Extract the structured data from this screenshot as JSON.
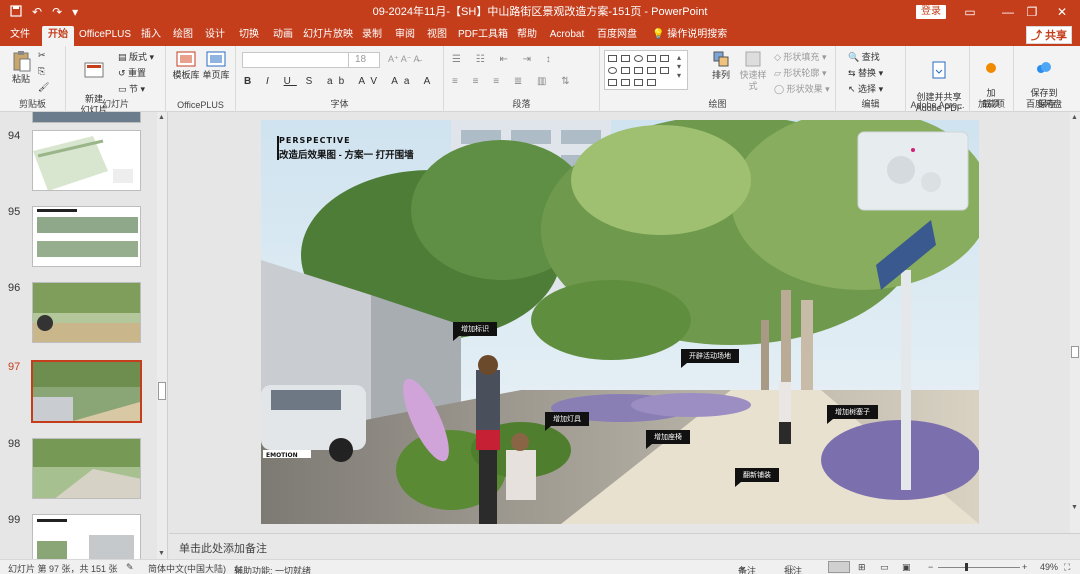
{
  "titlebar": {
    "title": "09-2024年11月-【SH】中山路街区景观改造方案-151页  -  PowerPoint",
    "login_label": "登录",
    "minimize_icon": "minimize-icon",
    "restore_icon": "restore-icon",
    "close_icon": "close-icon",
    "save_icon": "save-icon",
    "undo_icon": "undo-icon",
    "redo_icon": "redo-icon"
  },
  "menu": {
    "tabs": [
      "文件",
      "开始",
      "OfficePLUS",
      "插入",
      "绘图",
      "设计",
      "切换",
      "动画",
      "幻灯片放映",
      "录制",
      "审阅",
      "视图",
      "PDF工具箱",
      "帮助",
      "Acrobat",
      "百度网盘",
      "操作说明搜索"
    ],
    "active_tab": "开始",
    "share_label": "共享"
  },
  "ribbon": {
    "clipboard": {
      "paste": "粘贴",
      "label": "剪贴板"
    },
    "slides": {
      "new_slide": "新建\n幻灯片",
      "layout": "版式",
      "reset": "重置",
      "section": "节",
      "label": "幻灯片"
    },
    "officeplus": {
      "template_lib": "模板库",
      "single_lib": "单页库",
      "label": "OfficePLUS"
    },
    "font": {
      "font_name": "",
      "font_size": "18",
      "label": "字体"
    },
    "paragraph": {
      "label": "段落"
    },
    "drawing": {
      "arrange": "排列",
      "quick_styles": "快速样式",
      "fill": "形状填充",
      "outline": "形状轮廓",
      "effects": "形状效果",
      "label": "绘图"
    },
    "editing": {
      "find": "查找",
      "replace": "替换",
      "select": "选择",
      "label": "编辑"
    },
    "acrobat": {
      "create_share": "创建并共享\nAdobe PDF",
      "label": "Adobe Acro..."
    },
    "addins": {
      "load": "加\n载项",
      "label": "加载项"
    },
    "baidu": {
      "save": "保存到\n百度网盘",
      "label": "保存"
    }
  },
  "slides_panel": {
    "items": [
      {
        "num": "94"
      },
      {
        "num": "95"
      },
      {
        "num": "96"
      },
      {
        "num": "97"
      },
      {
        "num": "98"
      },
      {
        "num": "99"
      }
    ],
    "active": "97"
  },
  "slide": {
    "title_en": "PERSPECTIVE",
    "title_cn": "改造后效果图 - 方案一  打开围墙",
    "tags": [
      "增加标识",
      "开辟活动场地",
      "增加灯具",
      "增加座椅",
      "增加树塞子",
      "翻新铺装"
    ],
    "car_plate": "EMOTION"
  },
  "notes": {
    "placeholder": "单击此处添加备注"
  },
  "status": {
    "slide_info": "幻灯片 第 97 张，共 151 张",
    "language": "简体中文(中国大陆)",
    "accessibility": "辅助功能: 一切就绪",
    "notes_btn": "备注",
    "comments_btn": "批注",
    "zoom": "49%"
  }
}
